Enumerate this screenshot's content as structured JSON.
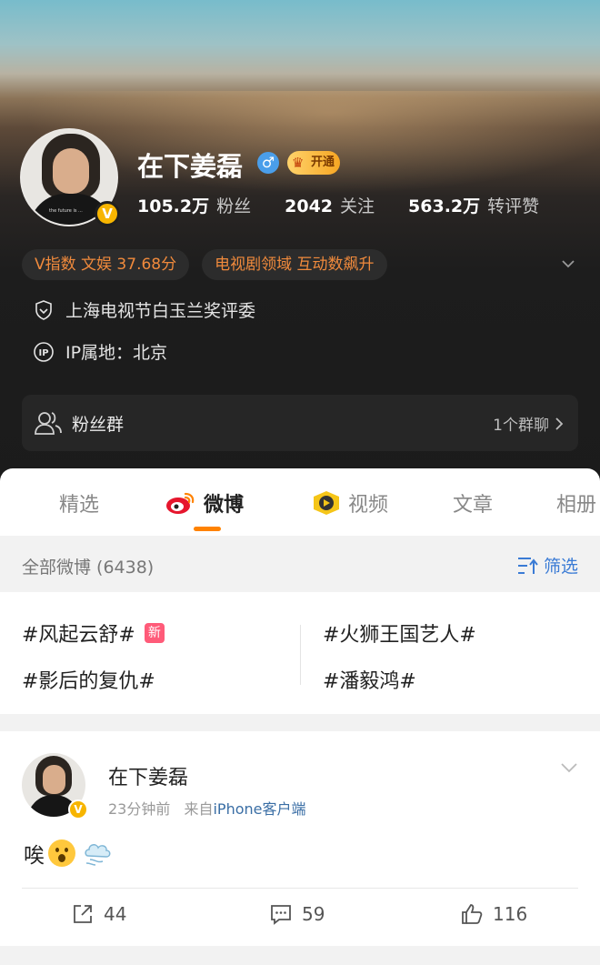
{
  "profile": {
    "name": "在下姜磊",
    "vip_label": "开通",
    "verified_mark": "V",
    "stats": [
      {
        "value": "105.2万",
        "label": "粉丝"
      },
      {
        "value": "2042",
        "label": "关注"
      },
      {
        "value": "563.2万",
        "label": "转评赞"
      }
    ],
    "pills": [
      "V指数 文娱 37.68分",
      "电视剧领域 互动数飙升"
    ],
    "info": [
      {
        "icon": "shield-icon",
        "text": "上海电视节白玉兰奖评委"
      },
      {
        "icon": "ip-icon",
        "text": "IP属地：北京"
      }
    ],
    "fan_group": {
      "title": "粉丝群",
      "right": "1个群聊"
    }
  },
  "tabs": [
    {
      "label": "精选",
      "active": false
    },
    {
      "label": "微博",
      "active": true,
      "icon": "weibo-logo-icon"
    },
    {
      "label": "视频",
      "active": false,
      "icon": "video-play-icon"
    },
    {
      "label": "文章",
      "active": false
    },
    {
      "label": "相册",
      "active": false
    }
  ],
  "filter_bar": {
    "count_label": "全部微博 (6438)",
    "filter_label": "筛选"
  },
  "topics": [
    {
      "text": "#风起云舒#",
      "badge": "新"
    },
    {
      "text": "#火狮王国艺人#"
    },
    {
      "text": "#影后的复仇#"
    },
    {
      "text": "#潘毅鸿#"
    }
  ],
  "post": {
    "author": "在下姜磊",
    "time": "23分钟前",
    "source_prefix": "来自",
    "source": "iPhone客户端",
    "text": "唉",
    "emojis": [
      "surprised-face-emoji",
      "puff-emoji"
    ],
    "actions": {
      "repost": "44",
      "comment": "59",
      "like": "116"
    }
  },
  "colors": {
    "accent_orange": "#ff8200",
    "pill_text": "#f08a3c",
    "link_blue": "#3a7bd5",
    "vip_gold": "#f7b500"
  }
}
